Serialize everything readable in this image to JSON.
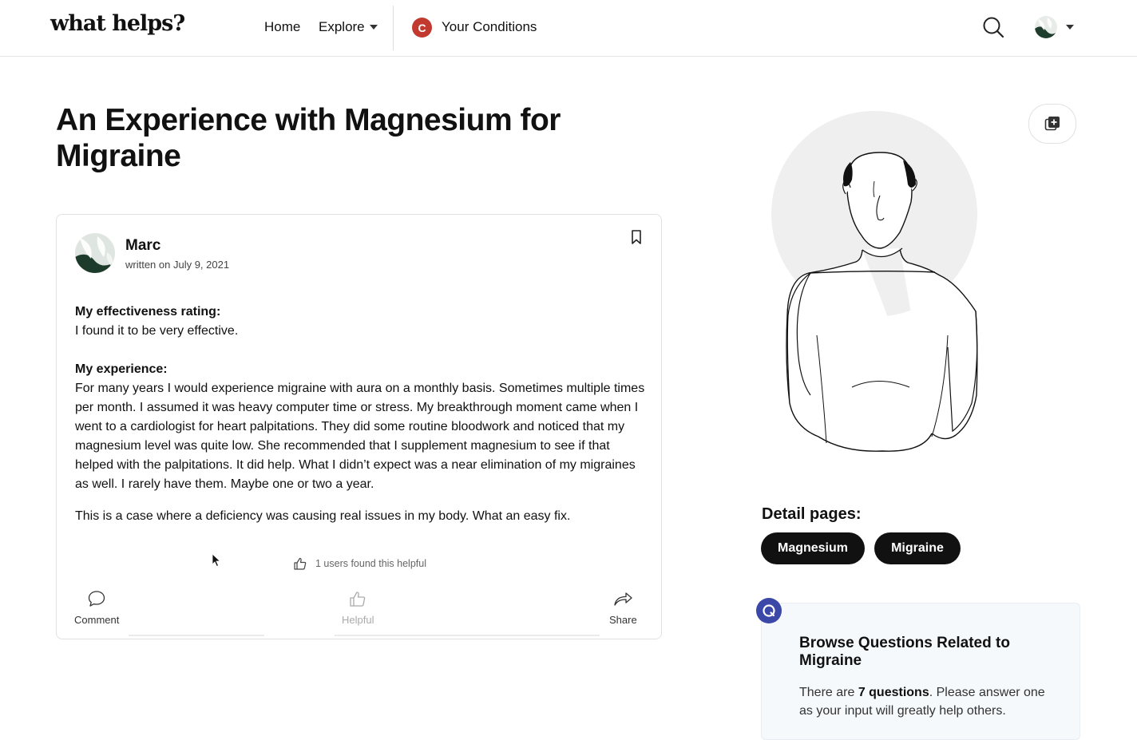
{
  "header": {
    "logo": "what helps?",
    "nav": {
      "home": "Home",
      "explore": "Explore",
      "conditions": "Your Conditions",
      "condition_initial": "C"
    }
  },
  "title": "An Experience with Magnesium for Migraine",
  "post": {
    "author": "Marc",
    "written_on": "written on July 9, 2021",
    "rating_label": "My effectiveness rating:",
    "rating_text": "I found it to be very effective.",
    "experience_label": "My experience:",
    "experience_text": "For many years I would experience migraine with aura on a monthly basis. Sometimes multiple times per month. I assumed it was heavy computer time or stress. My breakthrough moment came when I went to a cardiologist for heart palpitations. They did some routine bloodwork and noticed that my magnesium level was quite low. She recommended that I supplement magnesium to see if that helped with the palpitations. It did help. What I didn’t expect was a near elimination of my migraines as well. I rarely have them. Maybe one or two a year.",
    "closing_text": "This is a case where a deficiency was causing real issues in my body. What an easy fix.",
    "helpful_count_text": "1 users found this helpful",
    "actions": {
      "comment": "Comment",
      "helpful": "Helpful",
      "share": "Share"
    }
  },
  "sidebar": {
    "detail_heading": "Detail pages:",
    "detail_pages": [
      "Magnesium",
      "Migraine"
    ],
    "questions_card": {
      "title": "Browse Questions Related to Migraine",
      "text_prefix": "There are ",
      "count": "7 questions",
      "text_suffix": ". Please answer one as your input will greatly help others."
    }
  },
  "colors": {
    "accent_condition": "#c23a2f",
    "question_badge": "#3c48a8",
    "pill_bg": "#111111"
  }
}
